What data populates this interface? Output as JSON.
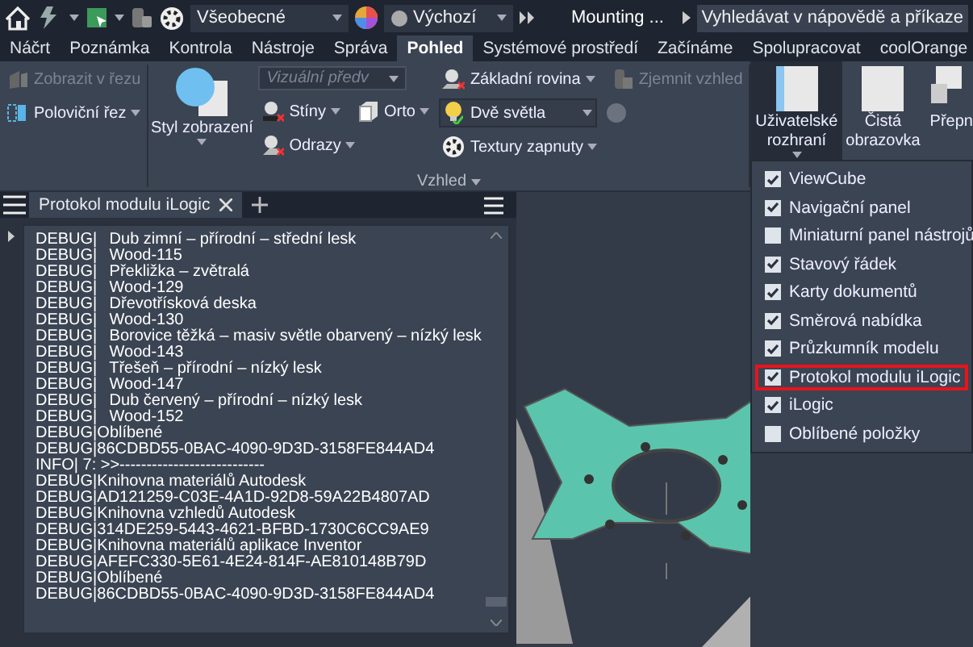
{
  "title_bar": {
    "style_dropdown": "Všeobecné",
    "appearance_dropdown": "Výchozí",
    "document_title": "Mounting ...",
    "search": {
      "placeholder": "Vyhledávat v nápovědě a příkaze"
    }
  },
  "tabs": [
    {
      "label": "Náčrt",
      "selected": false
    },
    {
      "label": "Poznámka",
      "selected": false
    },
    {
      "label": "Kontrola",
      "selected": false
    },
    {
      "label": "Nástroje",
      "selected": false
    },
    {
      "label": "Správa",
      "selected": false
    },
    {
      "label": "Pohled",
      "selected": true
    },
    {
      "label": "Systémové prostředí",
      "selected": false
    },
    {
      "label": "Začínáme",
      "selected": false
    },
    {
      "label": "Spolupracovat",
      "selected": false
    },
    {
      "label": "coolOrange",
      "selected": false
    }
  ],
  "ribbon": {
    "section_view": {
      "label": "Zobrazit v řezu",
      "disabled": true
    },
    "half_section": {
      "label": "Poloviční řez",
      "disabled": false
    },
    "visual_style": "Styl zobrazení",
    "visual_preset": {
      "placeholder": "Vizuální předv",
      "disabled": true
    },
    "shadows": "Stíny",
    "reflections": "Odrazy",
    "ortho": "Orto",
    "ground_plane": "Základní rovina",
    "refine": {
      "label": "Zjemnit vzhled",
      "disabled": true
    },
    "lighting": "Dvě světla",
    "textures": "Textury zapnuty",
    "group_label": "Vzhled",
    "ui_button": {
      "label": "Uživatelské rozhraní",
      "pressed": true
    },
    "clean_screen": "Čistá obrazovka",
    "switch_button": "Přepn"
  },
  "log_panel": {
    "tab": "Protokol modulu iLogic",
    "lines": [
      {
        "kind": "tabbed",
        "tag": "DEBUG|",
        "text": "Dub zimní – přírodní – střední lesk"
      },
      {
        "kind": "tabbed",
        "tag": "DEBUG|",
        "text": "Wood-115"
      },
      {
        "kind": "tabbed",
        "tag": "DEBUG|",
        "text": "Překližka – zvětralá"
      },
      {
        "kind": "tabbed",
        "tag": "DEBUG|",
        "text": "Wood-129"
      },
      {
        "kind": "tabbed",
        "tag": "DEBUG|",
        "text": "Dřevotřísková deska"
      },
      {
        "kind": "tabbed",
        "tag": "DEBUG|",
        "text": "Wood-130"
      },
      {
        "kind": "tabbed",
        "tag": "DEBUG|",
        "text": "Borovice těžká – masiv světle obarvený – nízký lesk"
      },
      {
        "kind": "tabbed",
        "tag": "DEBUG|",
        "text": "Wood-143"
      },
      {
        "kind": "tabbed",
        "tag": "DEBUG|",
        "text": "Třešeň – přírodní – nízký lesk"
      },
      {
        "kind": "tabbed",
        "tag": "DEBUG|",
        "text": "Wood-147"
      },
      {
        "kind": "tabbed",
        "tag": "DEBUG|",
        "text": "Dub červený – přírodní – nízký lesk"
      },
      {
        "kind": "tabbed",
        "tag": "DEBUG|",
        "text": "Wood-152"
      },
      {
        "kind": "plain",
        "text": "DEBUG|Oblíbené"
      },
      {
        "kind": "plain",
        "text": "DEBUG|86CDBD55-0BAC-4090-9D3D-3158FE844AD4"
      },
      {
        "kind": "plain",
        "text": "INFO| 7: >>---------------------------"
      },
      {
        "kind": "plain",
        "text": "DEBUG|Knihovna materiálů Autodesk"
      },
      {
        "kind": "plain",
        "text": "DEBUG|AD121259-C03E-4A1D-92D8-59A22B4807AD"
      },
      {
        "kind": "plain",
        "text": "DEBUG|Knihovna vzhledů Autodesk"
      },
      {
        "kind": "plain",
        "text": "DEBUG|314DE259-5443-4621-BFBD-1730C6CC9AE9"
      },
      {
        "kind": "plain",
        "text": "DEBUG|Knihovna materiálů aplikace Inventor"
      },
      {
        "kind": "plain",
        "text": "DEBUG|AFEFC330-5E61-4E24-814F-AE810148B79D"
      },
      {
        "kind": "plain",
        "text": "DEBUG|Oblíbené"
      },
      {
        "kind": "plain",
        "text": "DEBUG|86CDBD55-0BAC-4090-9D3D-3158FE844AD4"
      }
    ]
  },
  "ui_menu": [
    {
      "label": "ViewCube",
      "checked": true,
      "highlighted": false
    },
    {
      "label": "Navigační panel",
      "checked": true,
      "highlighted": false
    },
    {
      "label": "Miniaturní panel nástrojů",
      "checked": false,
      "highlighted": false
    },
    {
      "label": "Stavový řádek",
      "checked": true,
      "highlighted": false
    },
    {
      "label": "Karty dokumentů",
      "checked": true,
      "highlighted": false
    },
    {
      "label": "Směrová nabídka",
      "checked": true,
      "highlighted": false
    },
    {
      "label": "Průzkumník modelu",
      "checked": true,
      "highlighted": false
    },
    {
      "label": "Protokol modulu iLogic",
      "checked": true,
      "highlighted": true
    },
    {
      "label": "iLogic",
      "checked": true,
      "highlighted": false
    },
    {
      "label": "Oblíbené položky",
      "checked": false,
      "highlighted": false
    }
  ]
}
